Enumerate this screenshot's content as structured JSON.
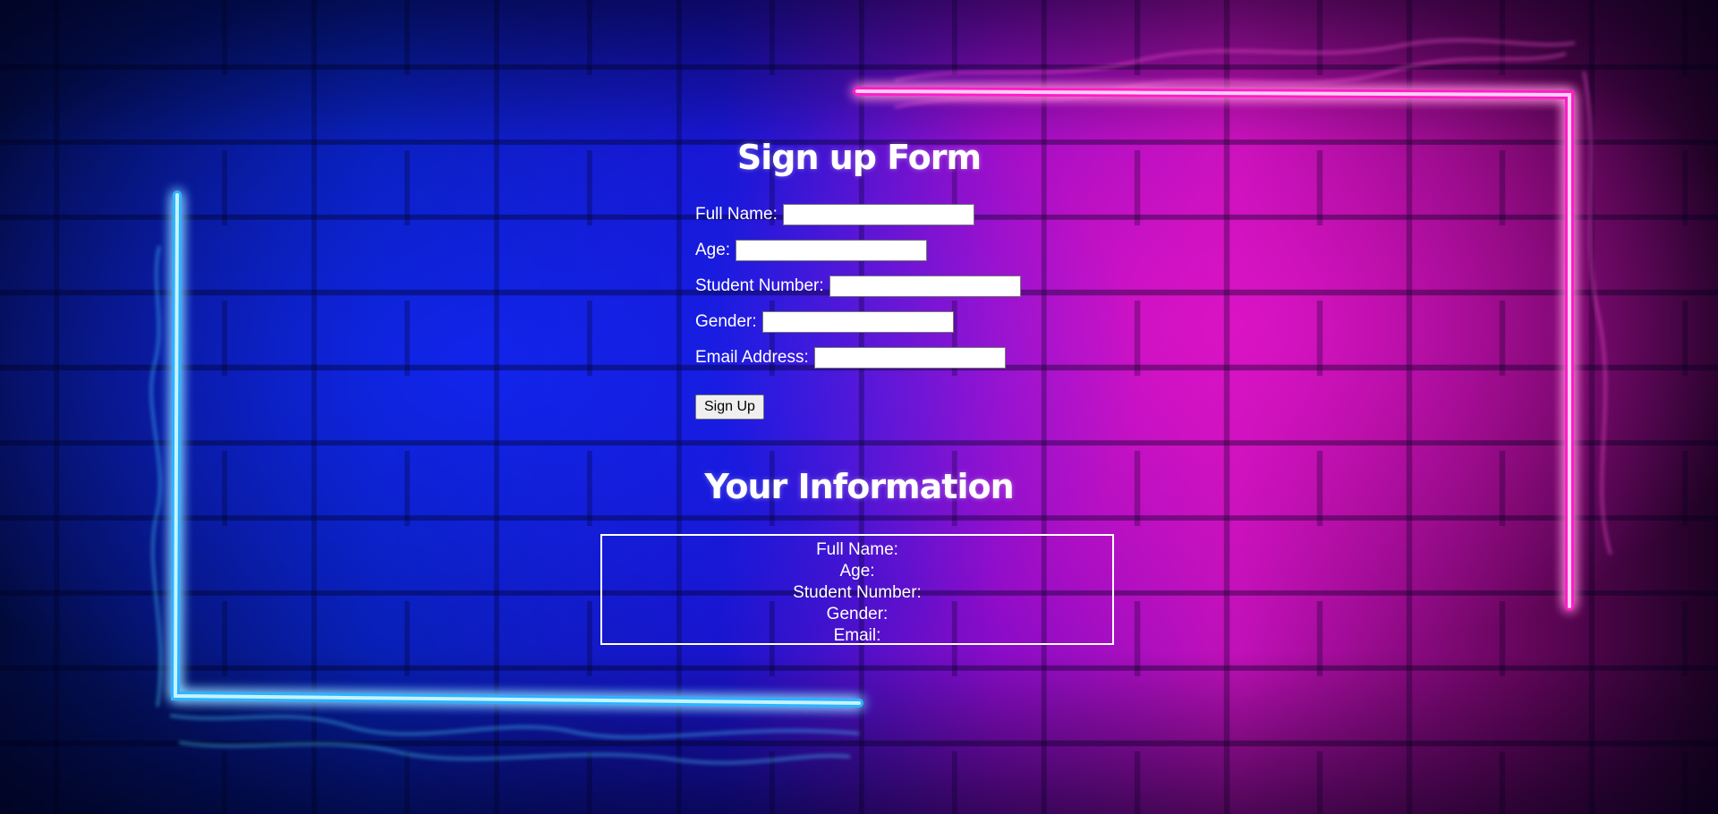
{
  "background": {
    "description_colors": {
      "left_blue": "#0a1fd0",
      "right_magenta": "#d012c0",
      "neon_cyan": "#5fd8ff",
      "neon_pink": "#ff3ad8"
    }
  },
  "signup": {
    "title": "Sign up Form",
    "fields": [
      {
        "label": "Full Name:",
        "value": ""
      },
      {
        "label": "Age:",
        "value": ""
      },
      {
        "label": "Student Number:",
        "value": ""
      },
      {
        "label": "Gender:",
        "value": ""
      },
      {
        "label": "Email Address:",
        "value": ""
      }
    ],
    "submit_label": "Sign Up"
  },
  "info": {
    "title": "Your Information",
    "lines": [
      "Full Name:",
      "Age:",
      "Student Number:",
      "Gender:",
      "Email:"
    ]
  }
}
